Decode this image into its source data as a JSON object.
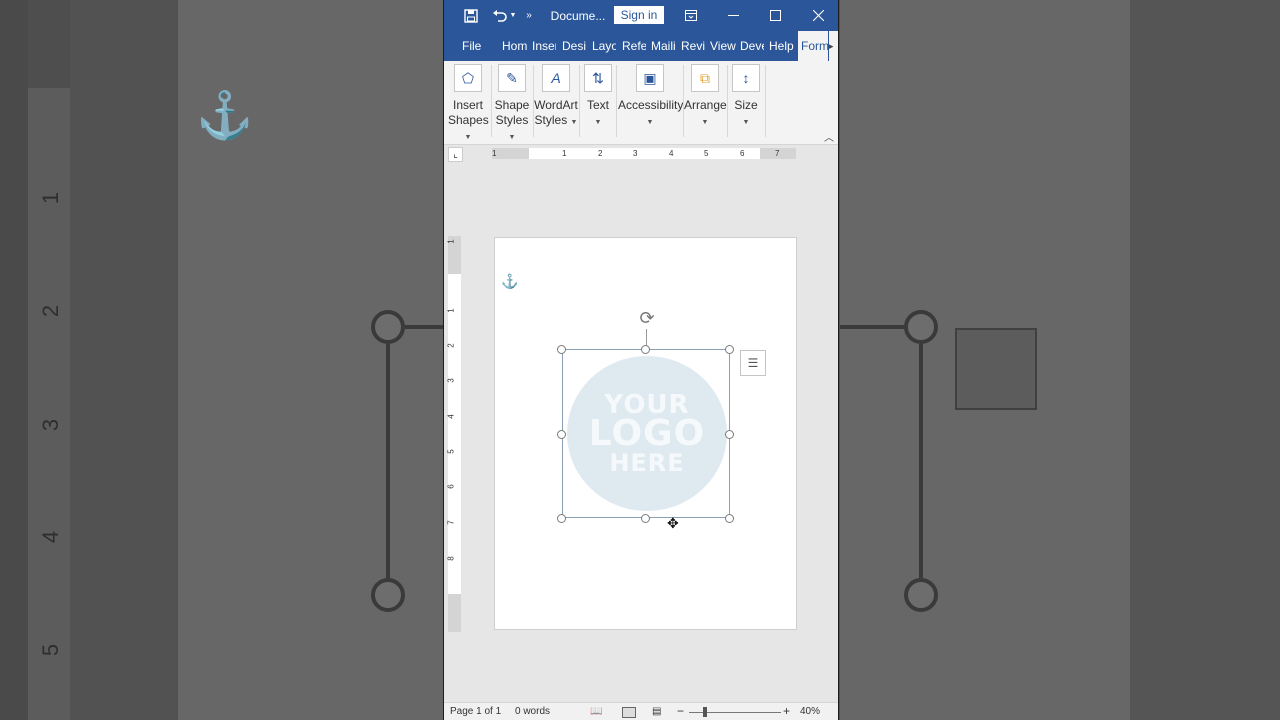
{
  "titlebar": {
    "doc_title": "Docume...",
    "signin_label": "Sign in",
    "save_icon": "save-icon",
    "undo_icon": "undo-icon",
    "more_icon": "more-commands-icon",
    "ribbon_display_icon": "ribbon-display-options-icon",
    "minimize_icon": "minimize-icon",
    "maximize_icon": "maximize-icon",
    "close_icon": "close-icon"
  },
  "tabs": [
    {
      "label": "File"
    },
    {
      "label": "Hom"
    },
    {
      "label": "Inser"
    },
    {
      "label": "Desi"
    },
    {
      "label": "Layo"
    },
    {
      "label": "Refe"
    },
    {
      "label": "Maili"
    },
    {
      "label": "Revi"
    },
    {
      "label": "View"
    },
    {
      "label": "Deve"
    },
    {
      "label": "Help"
    },
    {
      "label": "Form"
    }
  ],
  "ribbon": {
    "insert_shapes": {
      "line1": "Insert",
      "line2": "Shapes"
    },
    "shape_styles": {
      "line1": "Shape",
      "line2": "Styles"
    },
    "wordart_styles": {
      "line1": "WordArt",
      "line2": "Styles"
    },
    "text": {
      "line1": "Text"
    },
    "accessibility": {
      "line1": "Accessibility"
    },
    "arrange": {
      "line1": "Arrange"
    },
    "size": {
      "line1": "Size"
    }
  },
  "ruler_top_numbers": [
    "1",
    "1",
    "2",
    "3",
    "4",
    "5",
    "6",
    "7"
  ],
  "ruler_left_numbers": [
    "1",
    "1",
    "2",
    "3",
    "4",
    "5",
    "6",
    "7",
    "8"
  ],
  "document": {
    "logo_line1": "YOUR",
    "logo_line2": "LOGO",
    "logo_line3": "HERE"
  },
  "statusbar": {
    "page": "Page 1 of 1",
    "words": "0 words",
    "zoom_minus": "−",
    "zoom_plus": "+",
    "zoom_level": "40%"
  },
  "background": {
    "ruler_numbers": [
      "1",
      "2",
      "3",
      "4",
      "5"
    ]
  },
  "colors": {
    "accent": "#2b579a",
    "logo_circle": "#dfeaf0"
  }
}
